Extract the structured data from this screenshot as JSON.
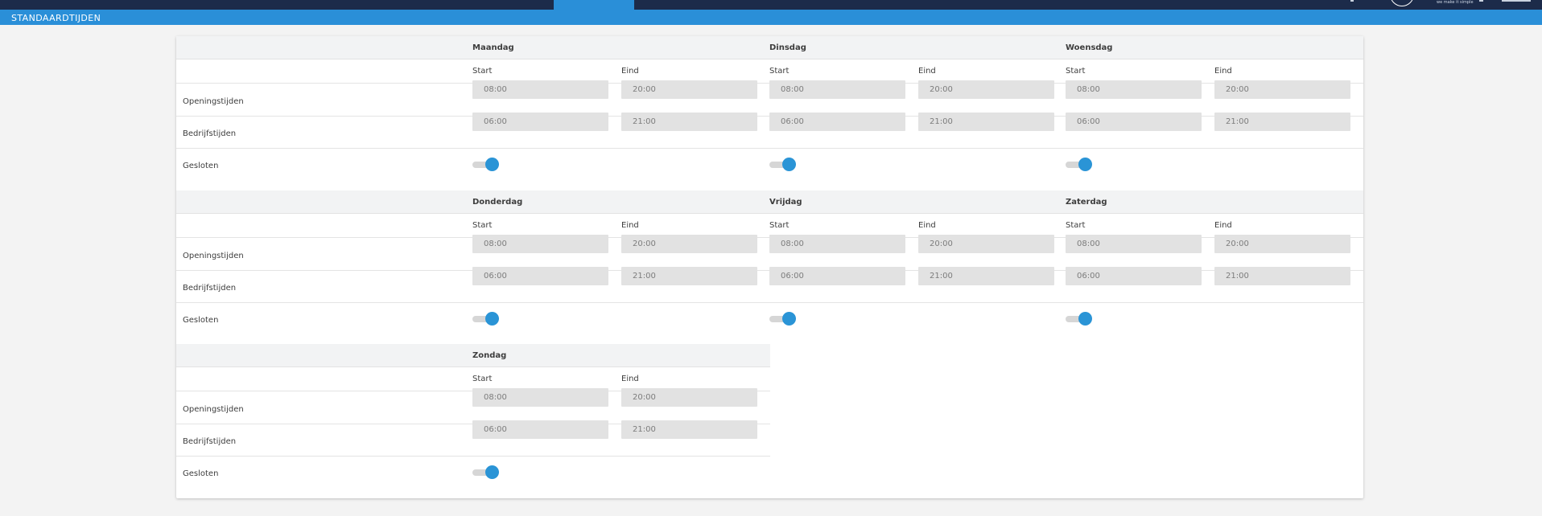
{
  "header": {
    "page_title": "STANDAARDTIJDEN",
    "brand_tagline": "we make it simple"
  },
  "labels": {
    "start": "Start",
    "end": "Eind",
    "opening": "Openingstijden",
    "business": "Bedrijfstijden",
    "closed": "Gesloten"
  },
  "days": [
    {
      "name": "Maandag",
      "opening_start": "08:00",
      "opening_end": "20:00",
      "business_start": "06:00",
      "business_end": "21:00",
      "closed": true
    },
    {
      "name": "Dinsdag",
      "opening_start": "08:00",
      "opening_end": "20:00",
      "business_start": "06:00",
      "business_end": "21:00",
      "closed": true
    },
    {
      "name": "Woensdag",
      "opening_start": "08:00",
      "opening_end": "20:00",
      "business_start": "06:00",
      "business_end": "21:00",
      "closed": true
    },
    {
      "name": "Donderdag",
      "opening_start": "08:00",
      "opening_end": "20:00",
      "business_start": "06:00",
      "business_end": "21:00",
      "closed": true
    },
    {
      "name": "Vrijdag",
      "opening_start": "08:00",
      "opening_end": "20:00",
      "business_start": "06:00",
      "business_end": "21:00",
      "closed": true
    },
    {
      "name": "Zaterdag",
      "opening_start": "08:00",
      "opening_end": "20:00",
      "business_start": "06:00",
      "business_end": "21:00",
      "closed": true
    },
    {
      "name": "Zondag",
      "opening_start": "08:00",
      "opening_end": "20:00",
      "business_start": "06:00",
      "business_end": "21:00",
      "closed": true
    }
  ],
  "colors": {
    "navbar": "#1c2b4a",
    "accent": "#2a8fd8",
    "toggle_on": "#2a94d6",
    "input_bg": "#e2e2e2"
  }
}
